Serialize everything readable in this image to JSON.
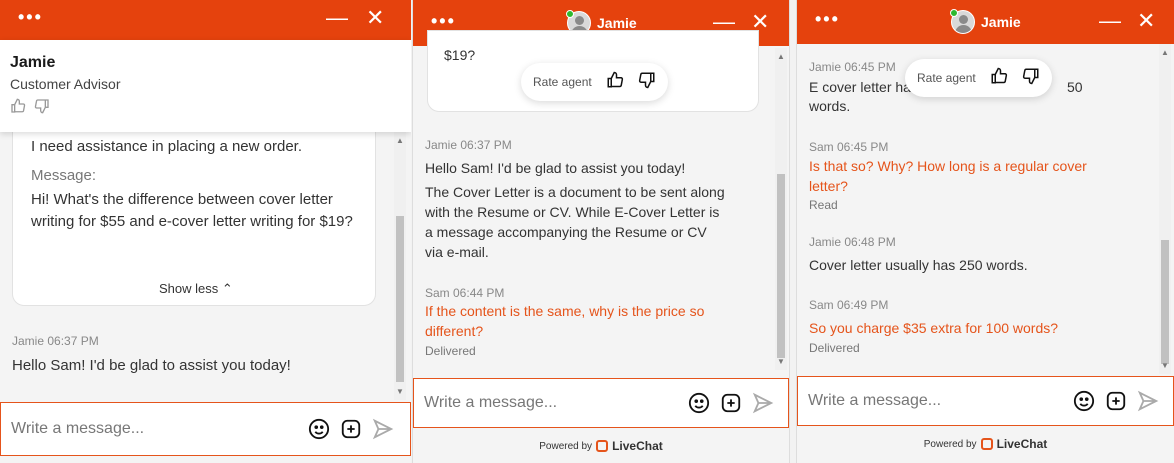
{
  "agent": {
    "name": "Jamie",
    "role": "Customer Advisor"
  },
  "header": {
    "menu_icon": "dots-icon",
    "minimize": "—",
    "close": "✕"
  },
  "rate": {
    "label": "Rate agent"
  },
  "composer": {
    "placeholder": "Write a message..."
  },
  "powered": {
    "prefix": "Powered by",
    "brand": "LiveChat"
  },
  "panel1": {
    "card_line1": "I need assistance in placing a new order.",
    "card_label": "Message:",
    "card_text": "Hi! What's the difference between cover letter writing for $55 and e-cover letter writing for $19?",
    "show_less": "Show less ⌃",
    "msg1_meta": "Jamie 06:37 PM",
    "msg1_text": "Hello Sam! I'd be glad to assist you today!"
  },
  "panel2": {
    "card_tail": "$19?",
    "msg1_meta": "Jamie 06:37 PM",
    "msg1_text": "Hello Sam! I'd be glad to assist you today!",
    "msg1_text2": "The Cover Letter is a document to be sent along with the Resume or CV. While E-Cover Letter is a message accompanying the Resume or CV via e-mail.",
    "msg2_meta": "Sam 06:44 PM",
    "msg2_text": "If the content is the same, why is the price so different?",
    "msg2_status": "Delivered"
  },
  "panel3": {
    "msg0_meta": "Jamie 06:45 PM",
    "msg0_text_a": "E cover letter ha",
    "msg0_text_b": "50",
    "msg0_text_c": "words.",
    "msg1_meta": "Sam 06:45 PM",
    "msg1_text": "Is that so? Why? How long is a regular cover letter?",
    "msg1_status": "Read",
    "msg2_meta": "Jamie 06:48 PM",
    "msg2_text": "Cover letter usually has 250 words.",
    "msg3_meta": "Sam 06:49 PM",
    "msg3_text": "So you charge $35 extra for 100 words?",
    "msg3_status": "Delivered"
  }
}
